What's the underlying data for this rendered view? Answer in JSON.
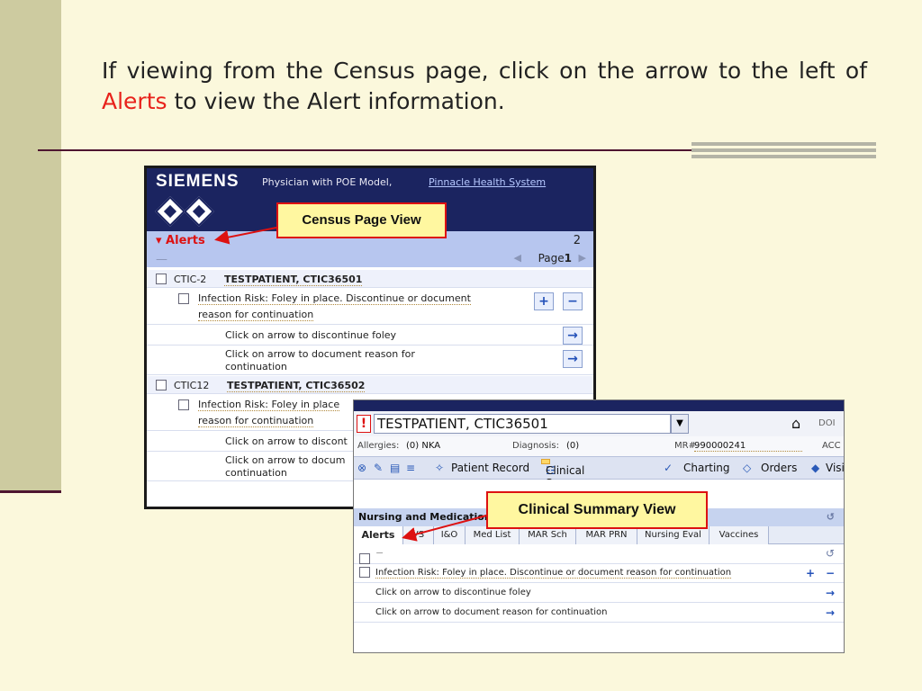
{
  "slide": {
    "headline_pre": "If viewing from the Census page, click on the arrow to the left of ",
    "headline_red": "Alerts",
    "headline_post": " to view the Alert information."
  },
  "census": {
    "brand": "SIEMENS",
    "subtitle": "Physician with POE Model,",
    "org_link": "Pinnacle Health System",
    "alerts_label": "▾ Alerts",
    "alerts_count": "2",
    "page_label": "Page",
    "page_num": "1",
    "patients": [
      {
        "id": "CTIC-2",
        "name": "TESTPATIENT, CTIC36501",
        "alert_line1": "Infection Risk: Foley in place. Discontinue or document",
        "alert_line2": "reason for continuation",
        "action1": "Click on arrow to discontinue foley",
        "action2_line1": "Click on arrow to document reason for",
        "action2_line2": "continuation"
      },
      {
        "id": "CTIC12",
        "name": "TESTPATIENT, CTIC36502",
        "alert_line1": "Infection Risk: Foley in place",
        "alert_line2": "reason for continuation",
        "action1": "Click on arrow to discont",
        "action2_line1": "Click on arrow to docum",
        "action2_line2": "continuation"
      }
    ]
  },
  "callouts": {
    "census": "Census Page View",
    "clinical": "Clinical Summary View"
  },
  "clinical": {
    "patient_name": "TESTPATIENT, CTIC36501",
    "doc_cut": "DOI",
    "allergies_label": "Allergies:",
    "allergies_value": "(0) NKA",
    "diagnosis_label": "Diagnosis:",
    "diagnosis_value": "(0)",
    "mr_label": "MR#",
    "mr_value": "990000241",
    "acc_cut": "ACC",
    "nav": {
      "patient_record": "Patient Record",
      "clinical_summary": "Clinical Summary",
      "charting": "Charting",
      "orders": "Orders",
      "visit_cut": "Visi"
    },
    "section_title": "Nursing and Medication",
    "tabs": [
      "Alerts",
      "VS",
      "I&O",
      "Med List",
      "MAR Sch",
      "MAR PRN",
      "Nursing Eval",
      "Vaccines"
    ],
    "rows": {
      "alert": "Infection Risk: Foley in place. Discontinue or document reason for continuation",
      "action1": "Click on arrow to discontinue foley",
      "action2": "Click on arrow to document reason for continuation"
    }
  }
}
